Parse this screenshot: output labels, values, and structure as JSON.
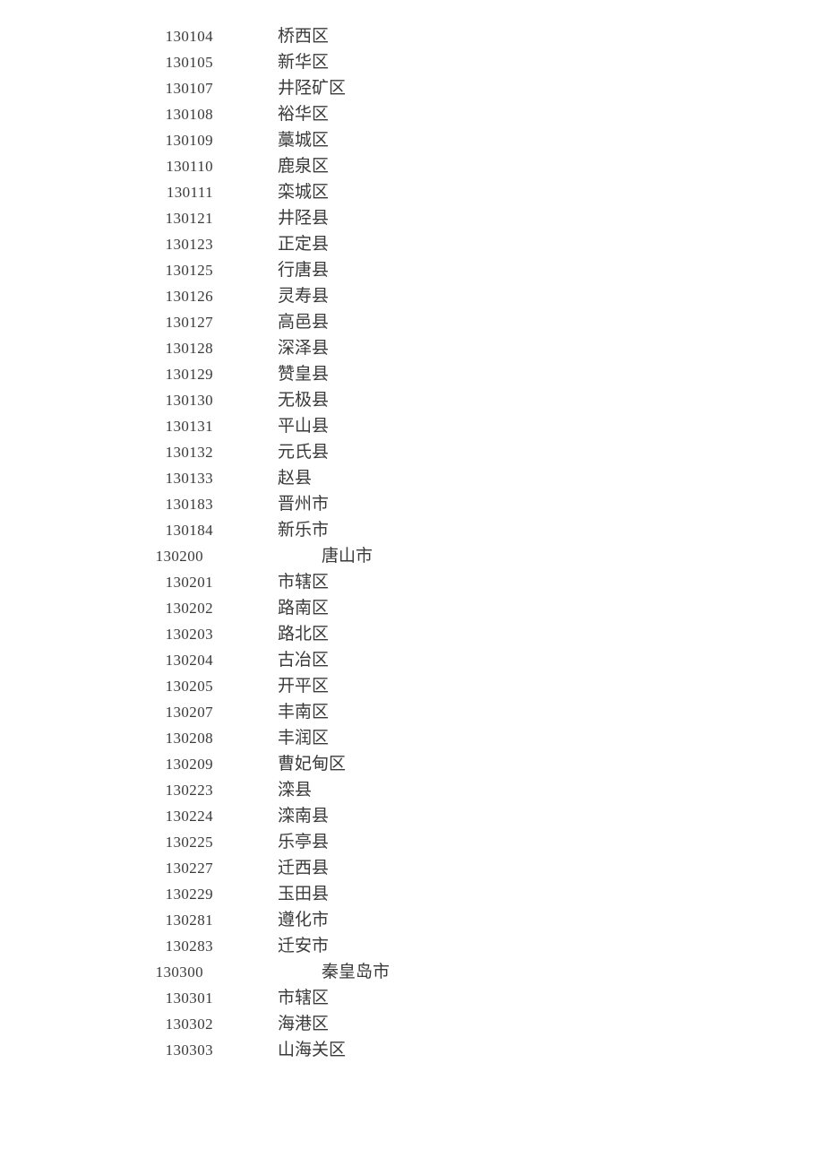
{
  "document": {
    "columns": {
      "code_header": "",
      "name_header": ""
    },
    "rows": [
      {
        "code": "130104",
        "name": "桥西区",
        "level": "district"
      },
      {
        "code": "130105",
        "name": "新华区",
        "level": "district"
      },
      {
        "code": "130107",
        "name": "井陉矿区",
        "level": "district"
      },
      {
        "code": "130108",
        "name": "裕华区",
        "level": "district"
      },
      {
        "code": "130109",
        "name": "藁城区",
        "level": "district"
      },
      {
        "code": "130110",
        "name": "鹿泉区",
        "level": "district"
      },
      {
        "code": "130111",
        "name": "栾城区",
        "level": "district"
      },
      {
        "code": "130121",
        "name": "井陉县",
        "level": "district"
      },
      {
        "code": "130123",
        "name": "正定县",
        "level": "district"
      },
      {
        "code": "130125",
        "name": "行唐县",
        "level": "district"
      },
      {
        "code": "130126",
        "name": "灵寿县",
        "level": "district"
      },
      {
        "code": "130127",
        "name": "高邑县",
        "level": "district"
      },
      {
        "code": "130128",
        "name": "深泽县",
        "level": "district"
      },
      {
        "code": "130129",
        "name": "赞皇县",
        "level": "district"
      },
      {
        "code": "130130",
        "name": "无极县",
        "level": "district"
      },
      {
        "code": "130131",
        "name": "平山县",
        "level": "district"
      },
      {
        "code": "130132",
        "name": "元氏县",
        "level": "district"
      },
      {
        "code": "130133",
        "name": "赵县",
        "level": "district"
      },
      {
        "code": "130183",
        "name": "晋州市",
        "level": "district"
      },
      {
        "code": "130184",
        "name": "新乐市",
        "level": "district"
      },
      {
        "code": "130200",
        "name": "唐山市",
        "level": "city"
      },
      {
        "code": "130201",
        "name": "市辖区",
        "level": "district"
      },
      {
        "code": "130202",
        "name": "路南区",
        "level": "district"
      },
      {
        "code": "130203",
        "name": "路北区",
        "level": "district"
      },
      {
        "code": "130204",
        "name": "古冶区",
        "level": "district"
      },
      {
        "code": "130205",
        "name": "开平区",
        "level": "district"
      },
      {
        "code": "130207",
        "name": "丰南区",
        "level": "district"
      },
      {
        "code": "130208",
        "name": "丰润区",
        "level": "district"
      },
      {
        "code": "130209",
        "name": "曹妃甸区",
        "level": "district"
      },
      {
        "code": "130223",
        "name": "滦县",
        "level": "district"
      },
      {
        "code": "130224",
        "name": "滦南县",
        "level": "district"
      },
      {
        "code": "130225",
        "name": "乐亭县",
        "level": "district"
      },
      {
        "code": "130227",
        "name": "迁西县",
        "level": "district"
      },
      {
        "code": "130229",
        "name": "玉田县",
        "level": "district"
      },
      {
        "code": "130281",
        "name": "遵化市",
        "level": "district"
      },
      {
        "code": "130283",
        "name": "迁安市",
        "level": "district"
      },
      {
        "code": "130300",
        "name": "秦皇岛市",
        "level": "city"
      },
      {
        "code": "130301",
        "name": "市辖区",
        "level": "district"
      },
      {
        "code": "130302",
        "name": "海港区",
        "level": "district"
      },
      {
        "code": "130303",
        "name": "山海关区",
        "level": "district"
      }
    ]
  },
  "style": {
    "text_color": "#3a3a3a",
    "background_color": "#ffffff"
  }
}
